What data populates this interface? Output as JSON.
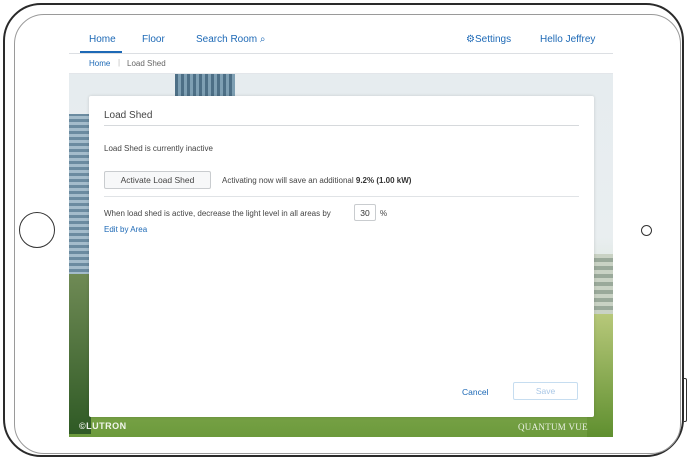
{
  "nav": {
    "home": "Home",
    "floor": "Floor",
    "search_room": "Search Room",
    "search_glyph": "⌕",
    "settings_glyph": "⚙",
    "settings": "Settings",
    "greeting": "Hello Jeffrey"
  },
  "breadcrumb": {
    "home": "Home",
    "separator": "|",
    "current": "Load Shed"
  },
  "dialog": {
    "title": "Load Shed",
    "status": "Load Shed is currently inactive",
    "activate_button": "Activate Load Shed",
    "save_note_prefix": "Activating now will save an additional",
    "save_note_value": "9.2% (1.00 kW)",
    "decrease_label": "When load shed is active, decrease the light level in all areas by",
    "decrease_value": "30",
    "decrease_unit": "%",
    "edit_link": "Edit by Area",
    "cancel_button": "Cancel",
    "save_button": "Save"
  },
  "branding": {
    "left_logo": "©LUTRON",
    "right_logo": "QUANTUM VUE"
  },
  "colors": {
    "accent": "#1d69b6",
    "save_disabled": "#a9c7e6"
  },
  "icons": {
    "search": "search-icon",
    "settings": "gear-icon"
  }
}
